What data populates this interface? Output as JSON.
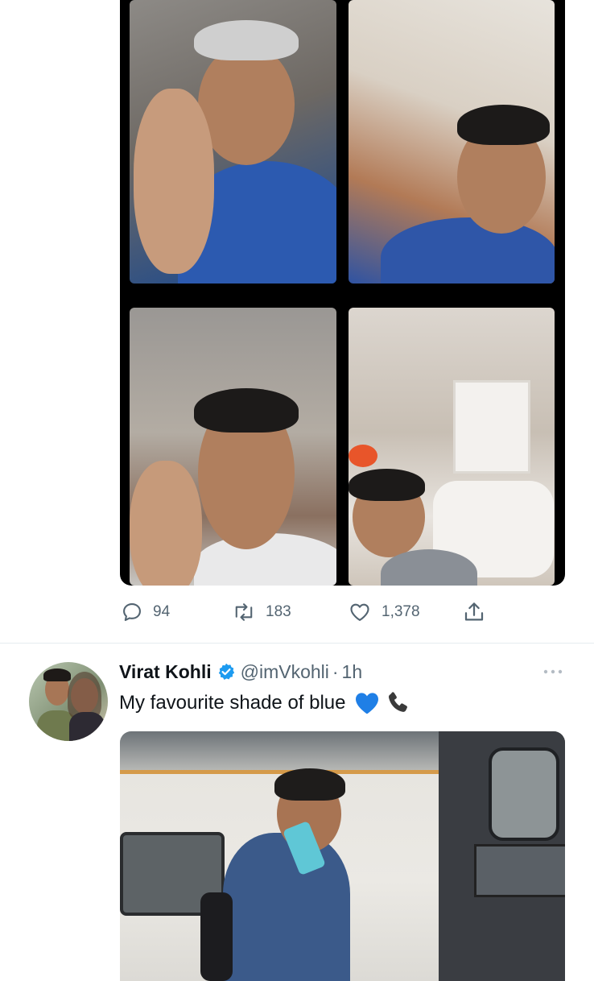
{
  "tweet1": {
    "stats": {
      "replies": "94",
      "retweets": "183",
      "likes": "1,378"
    },
    "icons": [
      "reply-icon",
      "retweet-icon",
      "like-icon",
      "share-icon"
    ]
  },
  "tweet2": {
    "author": "Virat Kohli",
    "handle": "@imVkohli",
    "separator": "·",
    "time": "1h",
    "text": "My favourite shade of blue",
    "emojis": [
      "blue-heart",
      "telephone-receiver"
    ],
    "verified": true
  },
  "colors": {
    "text": "#0f1419",
    "secondary": "#536471",
    "verified": "#1d9bf0",
    "divider": "#e6ecf0",
    "blue_heart": "#1f7fe6"
  }
}
